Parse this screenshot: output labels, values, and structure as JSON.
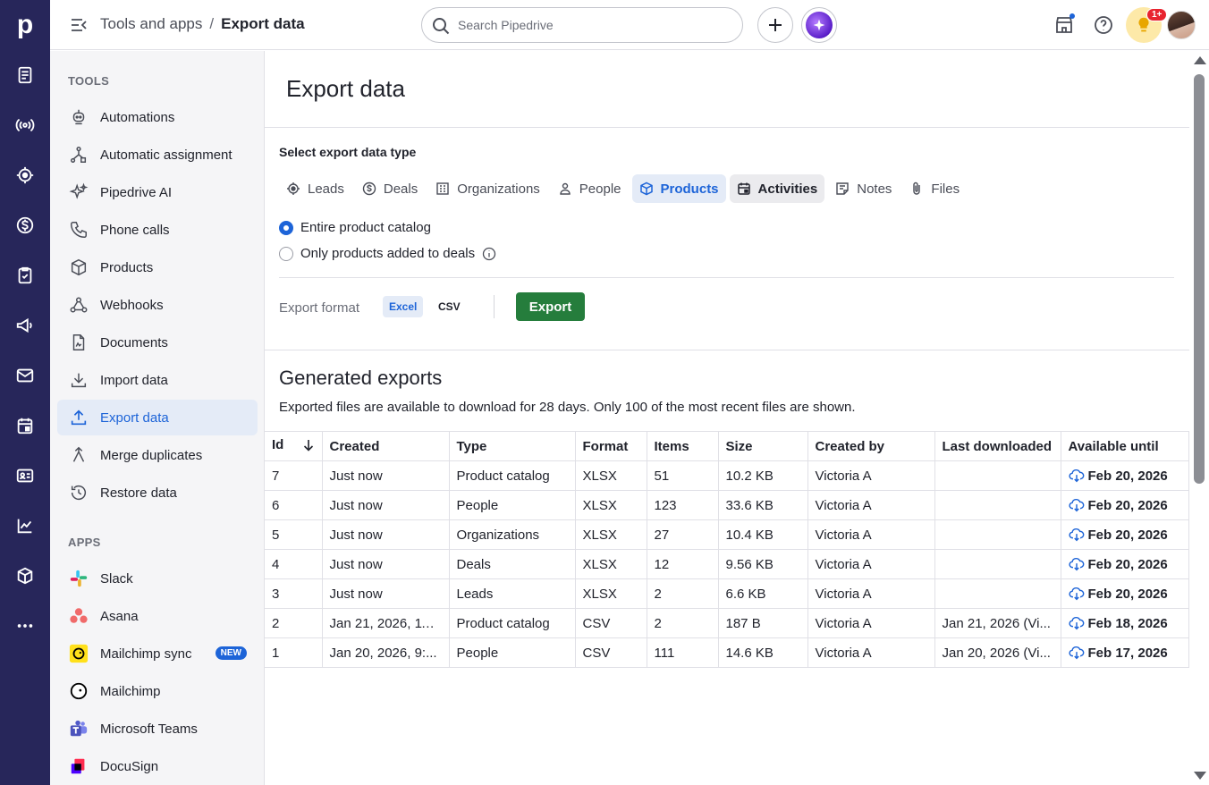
{
  "app": {
    "logo_letter": "p"
  },
  "breadcrumb": {
    "parent": "Tools and apps",
    "separator": "/",
    "current": "Export data"
  },
  "search": {
    "placeholder": "Search Pipedrive"
  },
  "notifications": {
    "count": "1+"
  },
  "sidebar": {
    "tools_title": "TOOLS",
    "tools": [
      {
        "label": "Automations",
        "icon": "robot-icon"
      },
      {
        "label": "Automatic assignment",
        "icon": "assignment-icon"
      },
      {
        "label": "Pipedrive AI",
        "icon": "sparkle-icon"
      },
      {
        "label": "Phone calls",
        "icon": "phone-icon"
      },
      {
        "label": "Products",
        "icon": "box-icon"
      },
      {
        "label": "Webhooks",
        "icon": "webhook-icon"
      },
      {
        "label": "Documents",
        "icon": "document-icon"
      },
      {
        "label": "Import data",
        "icon": "download-icon"
      },
      {
        "label": "Export data",
        "icon": "upload-icon",
        "active": true
      },
      {
        "label": "Merge duplicates",
        "icon": "merge-icon"
      },
      {
        "label": "Restore data",
        "icon": "restore-icon"
      }
    ],
    "apps_title": "APPS",
    "apps": [
      {
        "label": "Slack",
        "icon": "slack-icon"
      },
      {
        "label": "Asana",
        "icon": "asana-icon"
      },
      {
        "label": "Mailchimp sync",
        "icon": "mailchimp-icon",
        "badge": "NEW"
      },
      {
        "label": "Mailchimp",
        "icon": "mailchimp-icon"
      },
      {
        "label": "Microsoft Teams",
        "icon": "teams-icon"
      },
      {
        "label": "DocuSign",
        "icon": "docusign-icon"
      }
    ]
  },
  "main": {
    "title": "Export data",
    "select_label": "Select export data type",
    "tabs": [
      {
        "label": "Leads",
        "icon": "target-icon"
      },
      {
        "label": "Deals",
        "icon": "dollar-icon"
      },
      {
        "label": "Organizations",
        "icon": "building-icon"
      },
      {
        "label": "People",
        "icon": "person-icon"
      },
      {
        "label": "Products",
        "icon": "box-icon",
        "selected": true
      },
      {
        "label": "Activities",
        "icon": "calendar-icon",
        "hovered": true
      },
      {
        "label": "Notes",
        "icon": "note-icon"
      },
      {
        "label": "Files",
        "icon": "paperclip-icon"
      }
    ],
    "options": [
      {
        "label": "Entire product catalog",
        "checked": true
      },
      {
        "label": "Only products added to deals",
        "checked": false
      }
    ],
    "format_label": "Export format",
    "format_excel": "Excel",
    "format_csv": "CSV",
    "export_button": "Export",
    "generated_title": "Generated exports",
    "generated_subtitle": "Exported files are available to download for 28 days. Only 100 of the most recent files are shown."
  },
  "table": {
    "columns": [
      "Id",
      "Created",
      "Type",
      "Format",
      "Items",
      "Size",
      "Created by",
      "Last downloaded",
      "Available until"
    ],
    "rows": [
      [
        "7",
        "Just now",
        "Product catalog",
        "XLSX",
        "51",
        "10.2 KB",
        "Victoria A",
        "",
        "Feb 20, 2026"
      ],
      [
        "6",
        "Just now",
        "People",
        "XLSX",
        "123",
        "33.6 KB",
        "Victoria A",
        "",
        "Feb 20, 2026"
      ],
      [
        "5",
        "Just now",
        "Organizations",
        "XLSX",
        "27",
        "10.4 KB",
        "Victoria A",
        "",
        "Feb 20, 2026"
      ],
      [
        "4",
        "Just now",
        "Deals",
        "XLSX",
        "12",
        "9.56 KB",
        "Victoria A",
        "",
        "Feb 20, 2026"
      ],
      [
        "3",
        "Just now",
        "Leads",
        "XLSX",
        "2",
        "6.6 KB",
        "Victoria A",
        "",
        "Feb 20, 2026"
      ],
      [
        "2",
        "Jan 21, 2026, 11:...",
        "Product catalog",
        "CSV",
        "2",
        "187 B",
        "Victoria A",
        "Jan 21, 2026 (Vi...",
        "Feb 18, 2026"
      ],
      [
        "1",
        "Jan 20, 2026, 9:...",
        "People",
        "CSV",
        "111",
        "14.6 KB",
        "Victoria A",
        "Jan 20, 2026 (Vi...",
        "Feb 17, 2026"
      ]
    ]
  },
  "colors": {
    "rail": "#27265a",
    "accent": "#1d64d8",
    "export_button": "#257d3c",
    "active_bg": "#e4ebf7"
  }
}
